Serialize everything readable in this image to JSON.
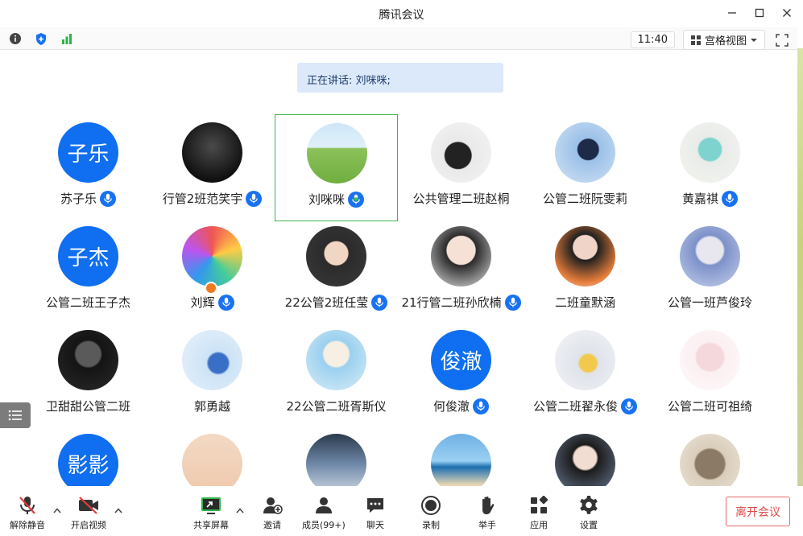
{
  "window": {
    "title": "腾讯会议"
  },
  "toolbar": {
    "clock": "11:40",
    "view_label": "宫格视图"
  },
  "speaking": {
    "text": "正在讲话: 刘咪咪;"
  },
  "colors": {
    "accent": "#1872f0",
    "active_border": "#39b54a",
    "leave": "#e04a4a"
  },
  "participants": [
    {
      "name": "苏子乐",
      "avatar_text": "子乐",
      "mic": true
    },
    {
      "name": "行管2班范笑宇",
      "avatar_text": "",
      "mic": true
    },
    {
      "name": "刘咪咪",
      "avatar_text": "",
      "mic": true,
      "speaking": true
    },
    {
      "name": "公共管理二班赵桐",
      "avatar_text": "",
      "mic": false
    },
    {
      "name": "公管二班阮雯莉",
      "avatar_text": "",
      "mic": false
    },
    {
      "name": "黄嘉祺",
      "avatar_text": "",
      "mic": true
    },
    {
      "name": "公管二班王子杰",
      "avatar_text": "子杰",
      "mic": false
    },
    {
      "name": "刘辉",
      "avatar_text": "",
      "mic": true,
      "badge": true
    },
    {
      "name": "22公管2班任莹",
      "avatar_text": "",
      "mic": true
    },
    {
      "name": "21行管二班孙欣楠",
      "avatar_text": "",
      "mic": true
    },
    {
      "name": "二班童默涵",
      "avatar_text": "",
      "mic": false
    },
    {
      "name": "公管一班芦俊玲",
      "avatar_text": "",
      "mic": false
    },
    {
      "name": "卫甜甜公管二班",
      "avatar_text": "",
      "mic": false
    },
    {
      "name": "郭勇越",
      "avatar_text": "",
      "mic": false
    },
    {
      "name": "22公管二班胥斯仪",
      "avatar_text": "",
      "mic": false
    },
    {
      "name": "何俊澈",
      "avatar_text": "俊澈",
      "mic": true
    },
    {
      "name": "公管二班翟永俊",
      "avatar_text": "",
      "mic": true
    },
    {
      "name": "公管二班可祖绮",
      "avatar_text": "",
      "mic": false
    },
    {
      "name": "",
      "avatar_text": "影影",
      "mic": false
    },
    {
      "name": "",
      "avatar_text": "",
      "mic": false
    },
    {
      "name": "",
      "avatar_text": "",
      "mic": false
    },
    {
      "name": "",
      "avatar_text": "",
      "mic": false
    },
    {
      "name": "",
      "avatar_text": "",
      "mic": false
    },
    {
      "name": "",
      "avatar_text": "",
      "mic": false
    }
  ],
  "bottombar": {
    "unmute": "解除静音",
    "start_video": "开启视频",
    "share_screen": "共享屏幕",
    "invite": "邀请",
    "members": "成员(99+)",
    "chat": "聊天",
    "record": "录制",
    "raise_hand": "举手",
    "apps": "应用",
    "settings": "设置",
    "leave": "离开会议"
  }
}
